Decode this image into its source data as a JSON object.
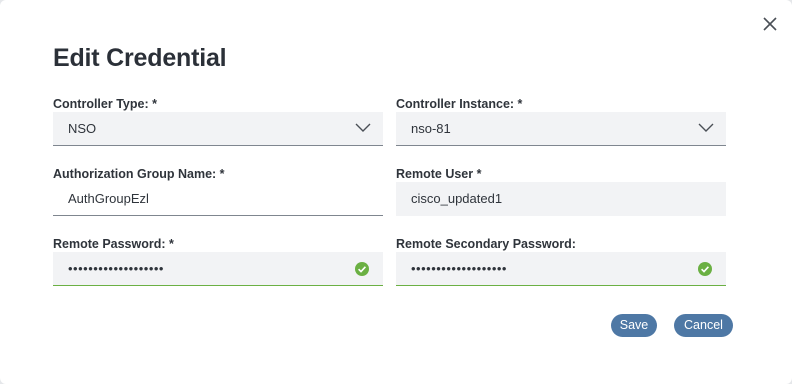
{
  "dialog": {
    "title": "Edit Credential"
  },
  "fields": {
    "controller_type": {
      "label": "Controller Type: *",
      "value": "NSO"
    },
    "controller_instance": {
      "label": "Controller Instance: *",
      "value": "nso-81"
    },
    "auth_group": {
      "label": "Authorization Group Name: *",
      "value": "AuthGroupEzl"
    },
    "remote_user": {
      "label": "Remote User *",
      "value": "cisco_updated1"
    },
    "remote_password": {
      "label": "Remote Password: *",
      "value": "•••••••••••••••••••"
    },
    "remote_secondary_password": {
      "label": "Remote Secondary Password:",
      "value": "•••••••••••••••••••"
    }
  },
  "buttons": {
    "save": "Save",
    "cancel": "Cancel"
  },
  "icons": {
    "close": "close-icon",
    "chevron": "chevron-down-icon",
    "check": "check-circle-icon"
  },
  "colors": {
    "primary_button": "#4e78a5",
    "valid": "#6bb043",
    "field_bg": "#f2f3f5"
  }
}
